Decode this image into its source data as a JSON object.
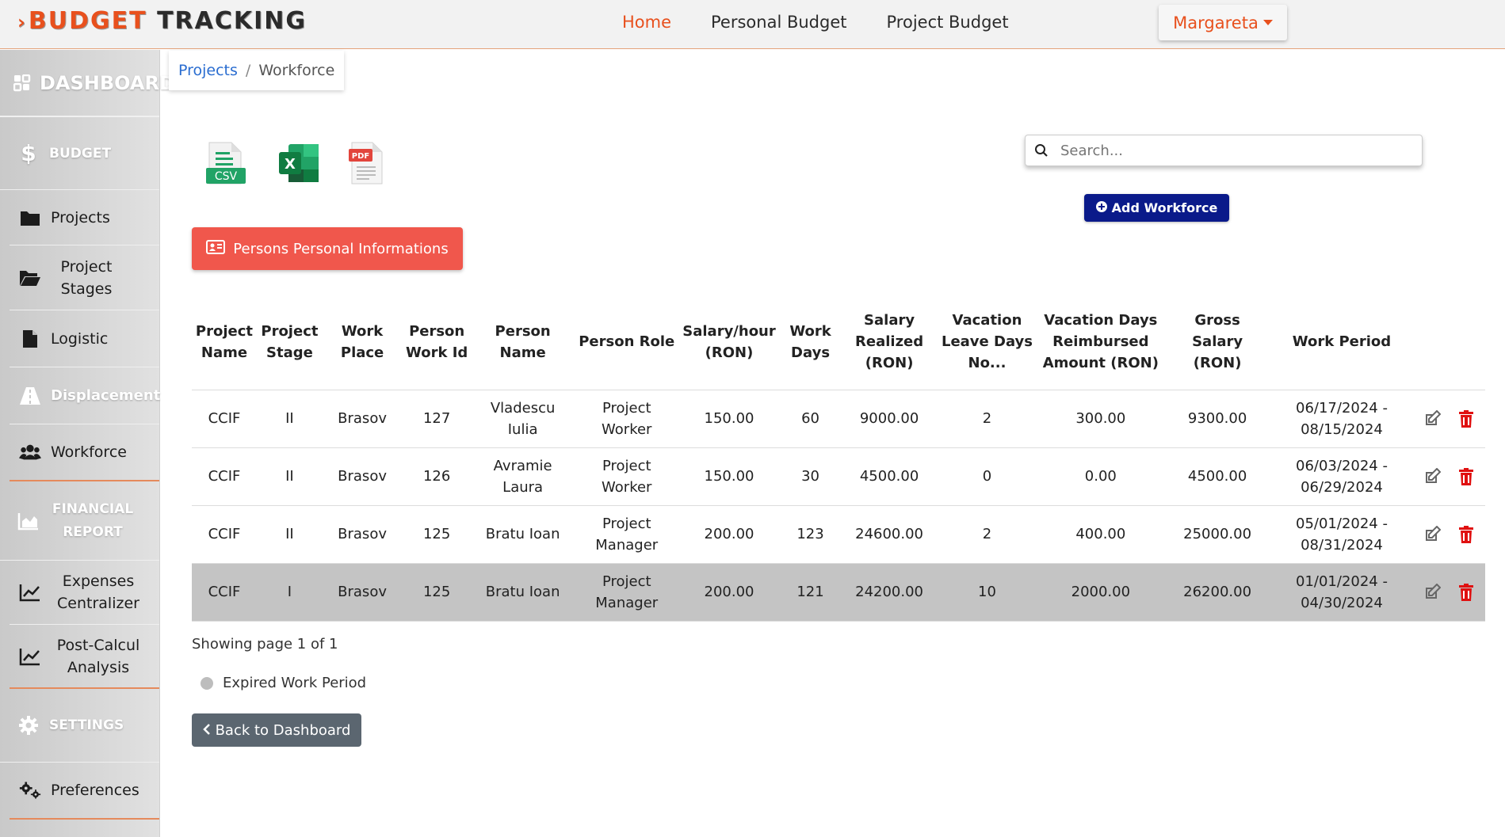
{
  "brand": {
    "part1": "BUDGET",
    "part2": "TRACKING"
  },
  "nav": {
    "home": "Home",
    "personal_budget": "Personal Budget",
    "project_budget": "Project Budget",
    "user": "Margareta"
  },
  "sidebar": {
    "dashboard": "DASHBOARD",
    "budget": "BUDGET",
    "projects": "Projects",
    "project_stages": "Project Stages",
    "logistic": "Logistic",
    "displacement": "Displacement",
    "workforce": "Workforce",
    "financial_report": "FINANCIAL REPORT",
    "expenses_centralizer": "Expenses Centralizer",
    "post_calcul": "Post-Calcul Analysis",
    "settings": "SETTINGS",
    "preferences": "Preferences"
  },
  "breadcrumb": {
    "link": "Projects",
    "separator": "/",
    "current": "Workforce"
  },
  "export": {
    "csv_label": "CSV",
    "excel_label": "X",
    "pdf_label": "PDF"
  },
  "search": {
    "placeholder": "Search..."
  },
  "buttons": {
    "add_workforce": "Add Workforce",
    "persons_info": "Persons Personal Informations",
    "back": "Back to Dashboard"
  },
  "table": {
    "headers": [
      "Project Name",
      "Project Stage",
      "Work Place",
      "Person Work Id",
      "Person Name",
      "Person Role",
      "Salary/hour (RON)",
      "Work Days",
      "Salary Realized (RON)",
      "Vacation Leave Days No...",
      "Vacation Days Reimbursed Amount (RON)",
      "Gross Salary (RON)",
      "Work Period"
    ],
    "rows": [
      [
        "CCIF",
        "II",
        "Brasov",
        "127",
        "Vladescu Iulia",
        "Project Worker",
        "150.00",
        "60",
        "9000.00",
        "2",
        "300.00",
        "9300.00",
        "06/17/2024 - 08/15/2024"
      ],
      [
        "CCIF",
        "II",
        "Brasov",
        "126",
        "Avramie Laura",
        "Project Worker",
        "150.00",
        "30",
        "4500.00",
        "0",
        "0.00",
        "4500.00",
        "06/03/2024 - 06/29/2024"
      ],
      [
        "CCIF",
        "II",
        "Brasov",
        "125",
        "Bratu Ioan",
        "Project Manager",
        "200.00",
        "123",
        "24600.00",
        "2",
        "400.00",
        "25000.00",
        "05/01/2024 - 08/31/2024"
      ],
      [
        "CCIF",
        "I",
        "Brasov",
        "125",
        "Bratu Ioan",
        "Project Manager",
        "200.00",
        "121",
        "24200.00",
        "10",
        "2000.00",
        "26200.00",
        "01/01/2024 - 04/30/2024"
      ]
    ]
  },
  "pagination": {
    "text": "Showing page 1 of 1"
  },
  "legend": {
    "expired": "Expired Work Period"
  },
  "colors": {
    "accent": "#e8501d",
    "add_button": "#0a1a8a",
    "persons_button": "#f0574c",
    "delete_icon": "#e01010",
    "expired_row": "#c4c4c4"
  }
}
